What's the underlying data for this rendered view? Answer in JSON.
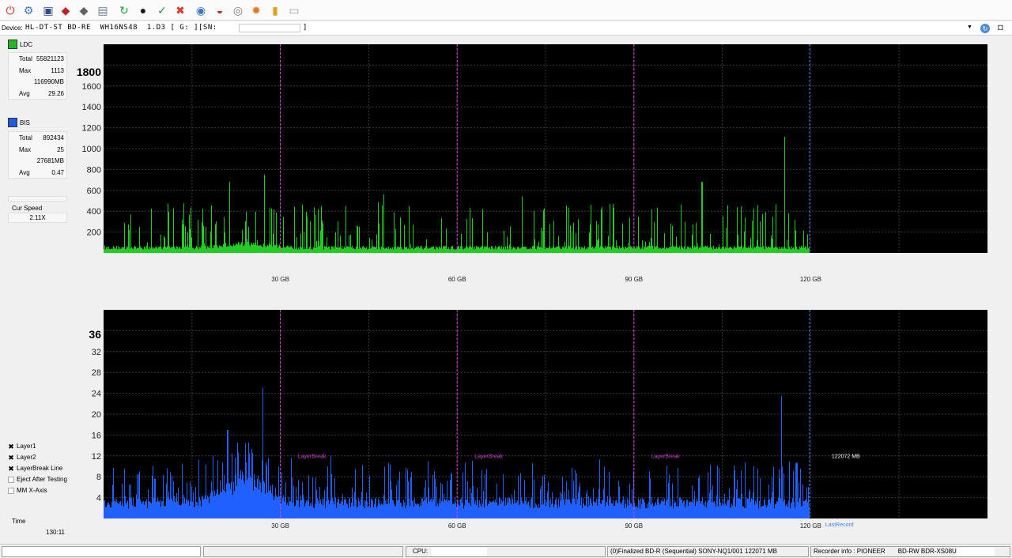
{
  "toolbar": {
    "buttons": [
      {
        "name": "power-icon",
        "glyph": "⏻",
        "color": "#d9261c"
      },
      {
        "name": "settings-icon",
        "glyph": "⚙",
        "color": "#3a78c3"
      },
      {
        "name": "drive-info-icon",
        "glyph": "▣",
        "color": "#2f4f8f"
      },
      {
        "name": "disc-red-icon",
        "glyph": "◆",
        "color": "#c0202a"
      },
      {
        "name": "disc-gray-icon",
        "glyph": "◆",
        "color": "#606060"
      },
      {
        "name": "scan-icon",
        "glyph": "▤",
        "color": "#6a7f9a"
      },
      {
        "name": "refresh-green-icon",
        "glyph": "↻",
        "color": "#1e9e3a"
      },
      {
        "name": "disc-start-icon",
        "glyph": "●",
        "color": "#1b1b1b"
      },
      {
        "name": "disc-check-icon",
        "glyph": "✓",
        "color": "#2a8f3f"
      },
      {
        "name": "stop-icon",
        "glyph": "✖",
        "color": "#e0392f"
      },
      {
        "name": "blue-disc-icon",
        "glyph": "◉",
        "color": "#3f74c9"
      },
      {
        "name": "erase-icon",
        "glyph": "◒",
        "color": "#b3262c"
      },
      {
        "name": "copy-disc-icon",
        "glyph": "◎",
        "color": "#7a7a7a"
      },
      {
        "name": "burn-icon",
        "glyph": "✹",
        "color": "#e07a1f"
      },
      {
        "name": "chart-icon",
        "glyph": "▮",
        "color": "#e0a21f"
      },
      {
        "name": "print-icon",
        "glyph": "▭",
        "color": "#9a9a9a"
      }
    ]
  },
  "device": {
    "label": "Device:",
    "text": "HL-DT-ST BD-RE  WH16NS48  1.D3 [ G: ][SN:",
    "close": "]"
  },
  "ldc": {
    "label": "LDC",
    "color": "#22b822",
    "rows": [
      {
        "k": "Total",
        "v": "55821123"
      },
      {
        "k": "Max",
        "v": "1113"
      },
      {
        "k": "",
        "v": "116990MB"
      },
      {
        "k": "Avg",
        "v": "29.26"
      }
    ]
  },
  "bis": {
    "label": "BIS",
    "color": "#1f5ce0",
    "rows": [
      {
        "k": "Total",
        "v": "892434"
      },
      {
        "k": "Max",
        "v": "25"
      },
      {
        "k": "",
        "v": "27681MB"
      },
      {
        "k": "Avg",
        "v": "0.47"
      }
    ]
  },
  "speed": {
    "label": "Cur Speed",
    "value": "2.11X"
  },
  "checks": [
    {
      "label": "Layer1",
      "checked": true
    },
    {
      "label": "Layer2",
      "checked": true
    },
    {
      "label": "LayerBreak Line",
      "checked": true
    },
    {
      "label": "Eject After Testing",
      "checked": false
    },
    {
      "label": "MM X-Axis",
      "checked": false
    }
  ],
  "time": {
    "label": "Time",
    "value": "130:11"
  },
  "chart_data": [
    {
      "type": "bar",
      "series": [
        {
          "name": "LDC",
          "color": "#22cc22"
        }
      ],
      "y_ticks": [
        200,
        400,
        600,
        800,
        1000,
        1200,
        1400,
        1600
      ],
      "ylim": [
        0,
        2000
      ],
      "y_top_label": "1800",
      "x_ticks": [
        30,
        60,
        90,
        120
      ],
      "x_tick_labels": [
        "30 GB",
        "60 GB",
        "90 GB",
        "120 GB"
      ],
      "xlim": [
        0,
        150
      ],
      "data_end_gb": 119.8,
      "layer_breaks_gb": [
        30,
        60,
        90
      ],
      "grid": true,
      "peaks": [
        [
          21.3,
          680
        ],
        [
          27.2,
          750
        ],
        [
          47.5,
          560
        ],
        [
          71,
          540
        ],
        [
          101.5,
          680
        ],
        [
          115.5,
          1113
        ]
      ],
      "baseline": 60
    },
    {
      "type": "bar",
      "series": [
        {
          "name": "BIS",
          "color": "#2060ff"
        }
      ],
      "y_ticks": [
        4,
        8,
        12,
        16,
        20,
        24,
        28,
        32
      ],
      "ylim": [
        0,
        40
      ],
      "y_top_label": "36",
      "x_ticks": [
        30,
        60,
        90,
        120
      ],
      "x_tick_labels": [
        "30 GB",
        "60 GB",
        "90 GB",
        "120 GB"
      ],
      "xlim": [
        0,
        150
      ],
      "data_end_gb": 119.8,
      "layer_breaks_gb": [
        30,
        60,
        90
      ],
      "layerbreak_label": "LayerBreak",
      "end_label": "122072 MB",
      "last_record_label": "LastRecord",
      "grid": true,
      "peaks": [
        [
          21,
          17
        ],
        [
          27,
          25
        ],
        [
          38.5,
          12
        ],
        [
          55,
          11
        ],
        [
          115,
          23.5
        ]
      ],
      "baseline": 3.5
    }
  ],
  "status": {
    "cpu_label": "CPU:",
    "disc_info": "(0)Finalized  BD-R (Sequential)  SONY-NQ1/001  122071 MB",
    "recorder_label": "Recorder info : PIONEER",
    "recorder_model": "BD-RW  BDR-XS08U"
  }
}
